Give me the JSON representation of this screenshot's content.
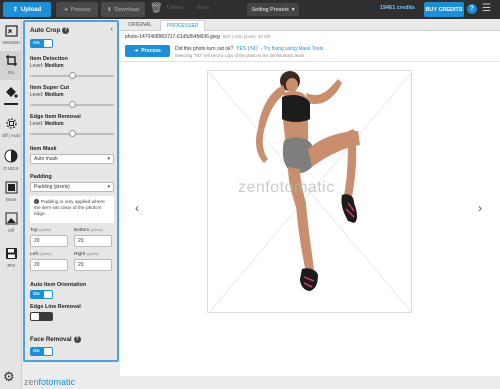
{
  "topbar": {
    "upload_label": "Upload",
    "process_label": "Process",
    "download_label": "Download",
    "faded_1": "Delete",
    "faded_2": "Save",
    "presets_label": "Setting Presets",
    "credits": "19461 credits",
    "buy_label": "BUY CREDITS",
    "help": "?"
  },
  "rail": {
    "items": [
      {
        "label": "500x600",
        "icon": "resize-icon"
      },
      {
        "label": "On",
        "icon": "crop-icon"
      },
      {
        "label": "",
        "icon": "paint-bucket-icon"
      },
      {
        "label": "Off | Auto",
        "icon": "rotate-icon"
      },
      {
        "label": "0:100:0",
        "icon": "contrast-icon"
      },
      {
        "label": "None",
        "icon": "shadow-icon"
      },
      {
        "label": "Off",
        "icon": "image-icon"
      },
      {
        "label": "JPG",
        "icon": "save-icon"
      }
    ]
  },
  "panel": {
    "auto_crop_title": "Auto Crop",
    "auto_crop_toggle": "On",
    "item_detection": "Item Detection",
    "item_detection_level": "Level:",
    "item_detection_value": "Medium",
    "item_detection_slider": 0.5,
    "item_super_cut": "Item Super Cut",
    "item_super_cut_level": "Level:",
    "item_super_cut_value": "Medium",
    "item_super_cut_slider": 0.5,
    "edge_removal": "Edge Item Removal",
    "edge_removal_level": "Level:",
    "edge_removal_value": "Medium",
    "edge_removal_slider": 0.5,
    "item_mask": "Item Mask",
    "item_mask_value": "Auto mask",
    "padding": "Padding",
    "padding_value": "Padding (pixels)",
    "padding_note": "Padding is only applied where the item sits clear of the photo's edge.",
    "top_label": "Top",
    "bottom_label": "Bottom",
    "left_label": "Left",
    "right_label": "Right",
    "unit": "(pixels)",
    "top_value": "20",
    "bottom_value": "20",
    "left_value": "20",
    "right_value": "20",
    "auto_orientation": "Auto Item Orientation",
    "auto_orientation_toggle": "On",
    "edge_line_removal": "Edge Line Removal",
    "face_removal": "Face Removal",
    "face_removal_toggle": "On"
  },
  "main": {
    "tab_original": "ORIGINAL",
    "tab_processed": "PROCESSED",
    "filename": "photo-1470468969717-61d5d54fd036.jpeg",
    "file_meta": "500 x 600 pixels, 30 KB",
    "process_label": "Process",
    "ask_text": "Did this photo turn out ok?",
    "yes": "YES",
    "no": "NO",
    "mask_tools": "Try fixing using Mask Tools",
    "ask_sub": "Selecting \"NO\" will send a copy of the photo to the Zenfotomatic team.",
    "watermark": "zenfotomatic",
    "prev": "‹",
    "next": "›"
  },
  "footer": {
    "brand_a": "zen",
    "brand_b": "fotomatic"
  },
  "colors": {
    "accent": "#1d8fd6",
    "topbar": "#2f2f2f",
    "panel_border": "#4aa3df"
  }
}
